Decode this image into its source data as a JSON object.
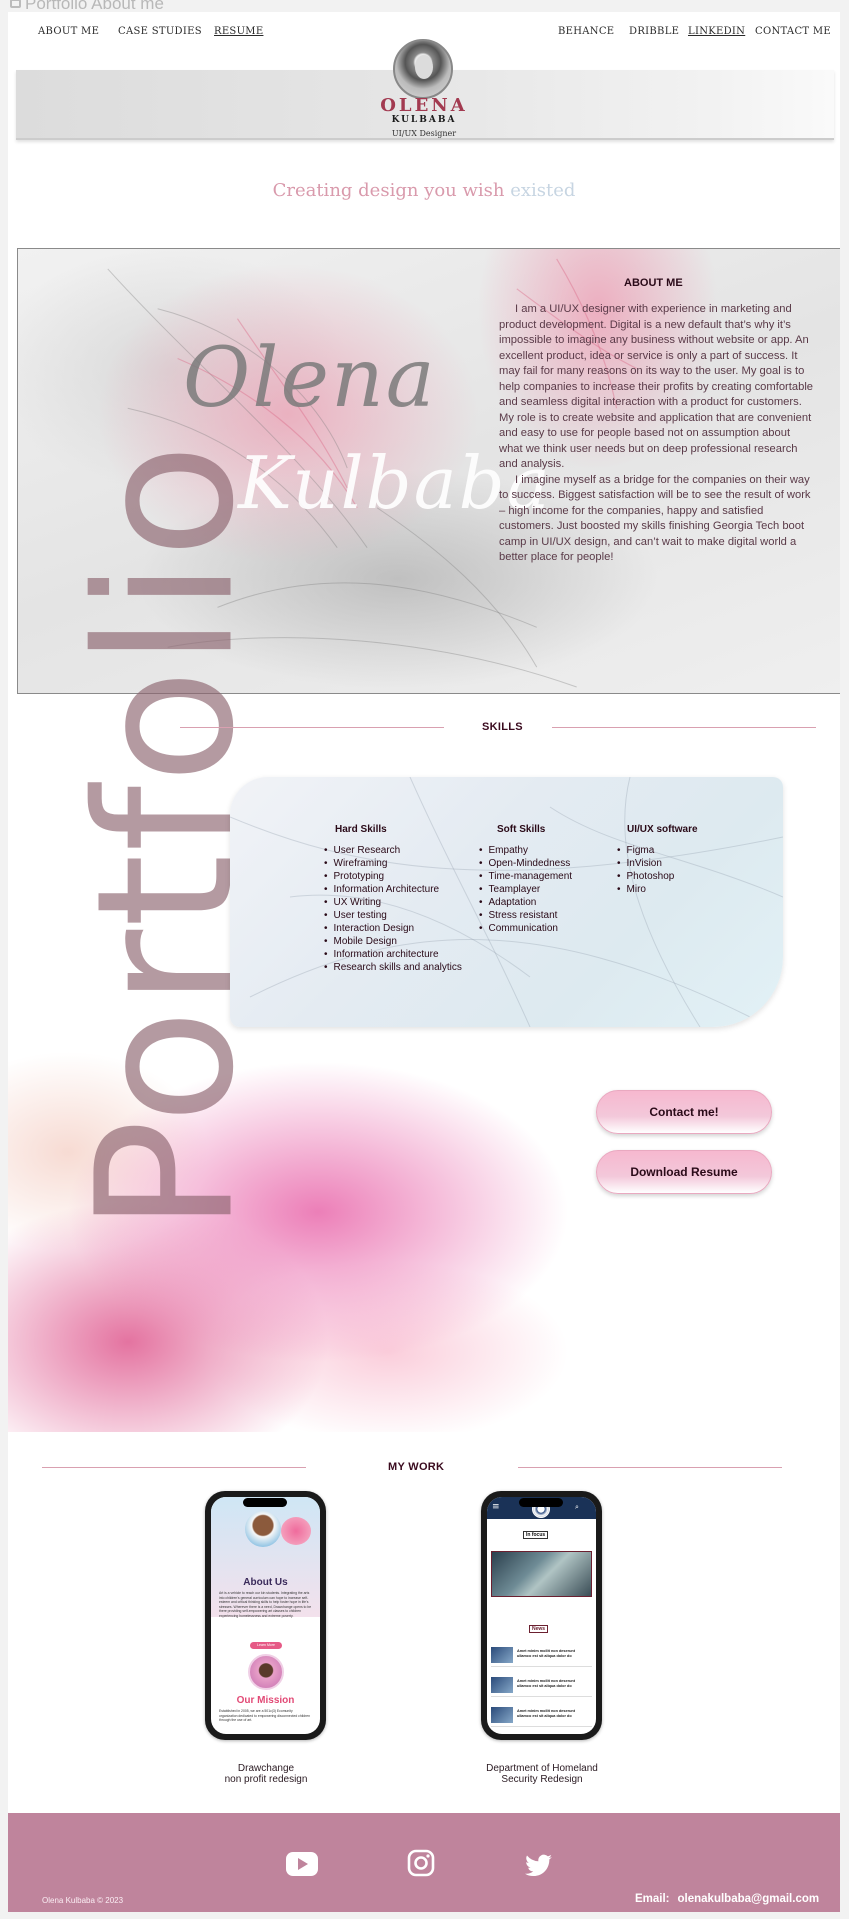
{
  "browser": {
    "tab_title": "Portfolio About me"
  },
  "nav": {
    "left": [
      "ABOUT ME",
      "CASE STUDIES",
      "RESUME"
    ],
    "right": [
      "BEHANCE",
      "DRIBBLE",
      "LINKEDIN",
      "CONTACT ME"
    ]
  },
  "header": {
    "name": "OLENA",
    "surname": "KULBABA",
    "role": "UI/UX Designer",
    "tagline_main": "Creating design you wish",
    "tagline_faded": "existed"
  },
  "about": {
    "signature_first": "Olena",
    "signature_last": "Kulbaba",
    "title": "ABOUT ME",
    "paragraph_1": "I am a UI/UX designer with experience in marketing and product development. Digital is a new default that’s why it’s impossible to imagine any business without website or app. An excellent product, idea or service is only a part of success. It may fail for many reasons on its way to the user. My goal is to help companies to increase their profits by creating comfortable and seamless digital interaction with a product for customers. My role is to create website and application that are convenient and easy to use for people based not on assumption about what we think user needs but on deep professional research and analysis.",
    "paragraph_2": "I imagine myself as a bridge for the companies on their way to success. Biggest satisfaction will be to see the result of work – high income for the companies, happy and satisfied customers. Just boosted my skills finishing Georgia Tech boot camp in UI/UX design, and can’t wait to make digital world a better place for people!"
  },
  "portfolio_word": "Portfolio",
  "skills": {
    "title": "SKILLS",
    "hard_title": "Hard Skills",
    "hard": [
      "User Research",
      "Wireframing",
      "Prototyping",
      "Information Architecture",
      "UX Writing",
      "User testing",
      "Interaction Design",
      "Mobile Design",
      "Information architecture",
      "Research skills and analytics"
    ],
    "soft_title": "Soft Skills",
    "soft": [
      "Empathy",
      "Open-Mindedness",
      "Time-management",
      "Teamplayer",
      "Adaptation",
      "Stress resistant",
      "Communication"
    ],
    "software_title": "UI/UX software",
    "software": [
      "Figma",
      "InVision",
      "Photoshop",
      "Miro"
    ]
  },
  "buttons": {
    "contact": "Contact me!",
    "download": "Download Resume"
  },
  "work": {
    "title": "MY WORK",
    "items": [
      {
        "caption_1": "Drawchange",
        "caption_2": "non profit redesign",
        "screen_heading": "About Us",
        "screen_text": "Art is a vehicle to reach our kin students. Integrating the arts into children's general curriculum can hope to increase self-esteem and critical thinking skills to help foster hope in life's stresses. Wherever there is a need, Drawchange opens to be there providing self-empowering art classes to children experiencing homelessness and extreme poverty.",
        "screen_button": "Learn More",
        "screen_mission": "Our Mission",
        "screen_mission_text": "Established in 2005, we are a 501c(3) Ecomunity organization dedicated to empowering disconnected children through the use of art."
      },
      {
        "caption_1": "Department of Homeland",
        "caption_2": "Security Redesign",
        "screen_focus": "In focus",
        "screen_news": "News",
        "news_item": "Amet minim mollit non deserunt ullamco est sit aliqua dolor do"
      }
    ]
  },
  "footer": {
    "copyright": "Olena Kulbaba © 2023",
    "email_label": "Email:",
    "email": "olenakulbaba@gmail.com",
    "socials": [
      "youtube",
      "instagram",
      "twitter"
    ],
    "color": "#bf849c"
  },
  "colors": {
    "accent_pink": "#d99aac",
    "brand": "#a23a50",
    "dark_text": "#3a0a1e"
  }
}
